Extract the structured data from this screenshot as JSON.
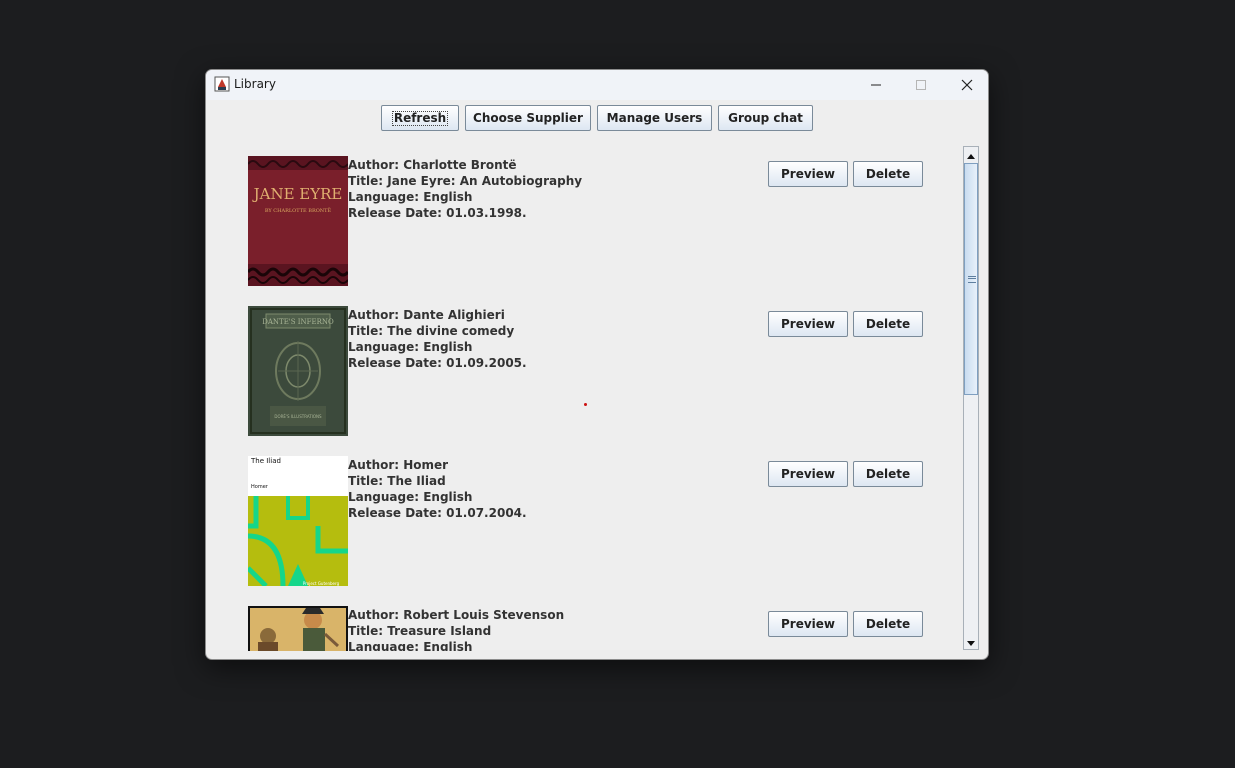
{
  "window": {
    "title": "Library"
  },
  "toolbar": {
    "refresh_label": "Refresh",
    "choose_supplier_label": "Choose Supplier",
    "manage_users_label": "Manage Users",
    "group_chat_label": "Group chat"
  },
  "books": [
    {
      "author": "Author: Charlotte Brontë",
      "title": "Title: Jane Eyre: An Autobiography",
      "language": "Language: English",
      "release": "Release Date: 01.03.1998.",
      "cover_text": "JANE EYRE",
      "cover_subtext": "BY CHARLOTTE BRONTË",
      "preview_label": "Preview",
      "delete_label": "Delete"
    },
    {
      "author": "Author: Dante Alighieri",
      "title": "Title: The divine comedy",
      "language": "Language: English",
      "release": "Release Date: 01.09.2005.",
      "cover_text": "DANTE'S INFERNO",
      "cover_subtext": "DORÉ'S ILLUSTRATIONS",
      "preview_label": "Preview",
      "delete_label": "Delete"
    },
    {
      "author": "Author: Homer",
      "title": "Title: The Iliad",
      "language": "Language: English",
      "release": "Release Date: 01.07.2004.",
      "cover_text": "The Iliad",
      "cover_subtext": "Homer",
      "cover_footer": "Project Gutenberg",
      "preview_label": "Preview",
      "delete_label": "Delete"
    },
    {
      "author": "Author: Robert Louis Stevenson",
      "title": "Title: Treasure Island",
      "language": "Language: English",
      "release": "",
      "preview_label": "Preview",
      "delete_label": "Delete"
    }
  ],
  "colors": {
    "button_border": "#7a8a99",
    "scroll_thumb": "#c9dcf0",
    "window_bg": "#eeeeee",
    "desktop_bg": "#1c1d1f"
  },
  "icons": {
    "app": "java-cup-icon",
    "minimize": "minimize-icon",
    "maximize": "maximize-icon",
    "close": "close-icon"
  }
}
